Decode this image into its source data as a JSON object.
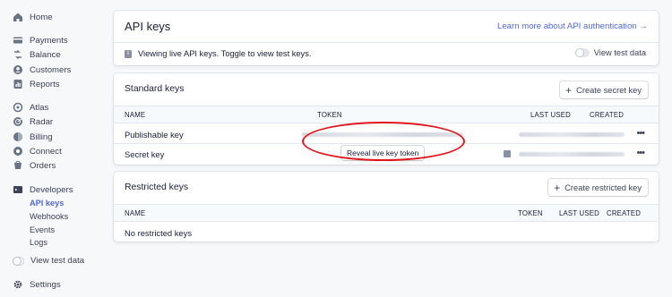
{
  "sidebar": {
    "home": "Home",
    "payments": "Payments",
    "balance": "Balance",
    "customers": "Customers",
    "reports": "Reports",
    "atlas": "Atlas",
    "radar": "Radar",
    "billing": "Billing",
    "connect": "Connect",
    "orders": "Orders",
    "developers": "Developers",
    "sub": {
      "api_keys": "API keys",
      "webhooks": "Webhooks",
      "events": "Events",
      "logs": "Logs"
    },
    "view_test_data": "View test data",
    "settings": "Settings"
  },
  "header": {
    "title": "API keys",
    "link": "Learn more about API authentication →",
    "info": "Viewing live API keys. Toggle to view test keys.",
    "toggle_label": "View test data"
  },
  "standard": {
    "title": "Standard keys",
    "button": "Create secret key",
    "columns": {
      "name": "NAME",
      "token": "TOKEN",
      "last_used": "LAST USED",
      "created": "CREATED"
    },
    "rows": [
      {
        "name": "Publishable key"
      },
      {
        "name": "Secret key",
        "reveal": "Reveal live key token"
      }
    ]
  },
  "restricted": {
    "title": "Restricted keys",
    "button": "Create restricted key",
    "columns": {
      "name": "NAME",
      "token": "TOKEN",
      "last_used": "LAST USED",
      "created": "CREATED"
    },
    "empty": "No restricted keys"
  },
  "colors": {
    "accent": "#5469d4",
    "annotation": "#e0161f"
  }
}
